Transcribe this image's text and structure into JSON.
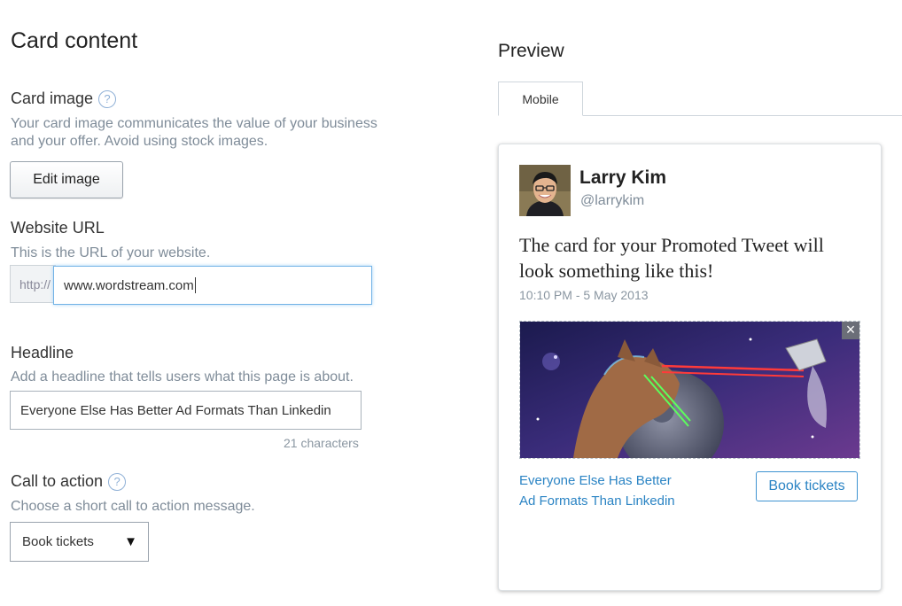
{
  "left": {
    "title": "Card content",
    "card_image": {
      "label": "Card image",
      "help_icon": "question-circle-icon",
      "help_text_line1": "Your card image communicates the value of your business",
      "help_text_line2": "and your offer. Avoid using stock images.",
      "edit_button": "Edit image"
    },
    "website": {
      "label": "Website URL",
      "help_text": "This is the URL of your website.",
      "prefix": "http://",
      "value": "www.wordstream.com"
    },
    "headline": {
      "label": "Headline",
      "help_text": "Add a headline that tells users what this page is about.",
      "value": "Everyone Else Has Better Ad Formats Than Linkedin",
      "char_count": "21 characters"
    },
    "cta": {
      "label": "Call to action",
      "help_icon": "question-circle-icon",
      "help_text": "Choose a short call to action message.",
      "selected": "Book tickets",
      "arrow": "▼"
    }
  },
  "preview": {
    "title": "Preview",
    "tab_mobile": "Mobile",
    "tweet": {
      "name": "Larry Kim",
      "handle": "@larrykim",
      "text_line1": "The card for your Promoted Tweet will",
      "text_line2": "look something like this!",
      "timestamp": "10:10 PM - 5 May 2013",
      "close": "×",
      "card_title_line1": "Everyone Else Has Better",
      "card_title_line2": "Ad Formats Than Linkedin",
      "cta": "Book tickets"
    }
  }
}
